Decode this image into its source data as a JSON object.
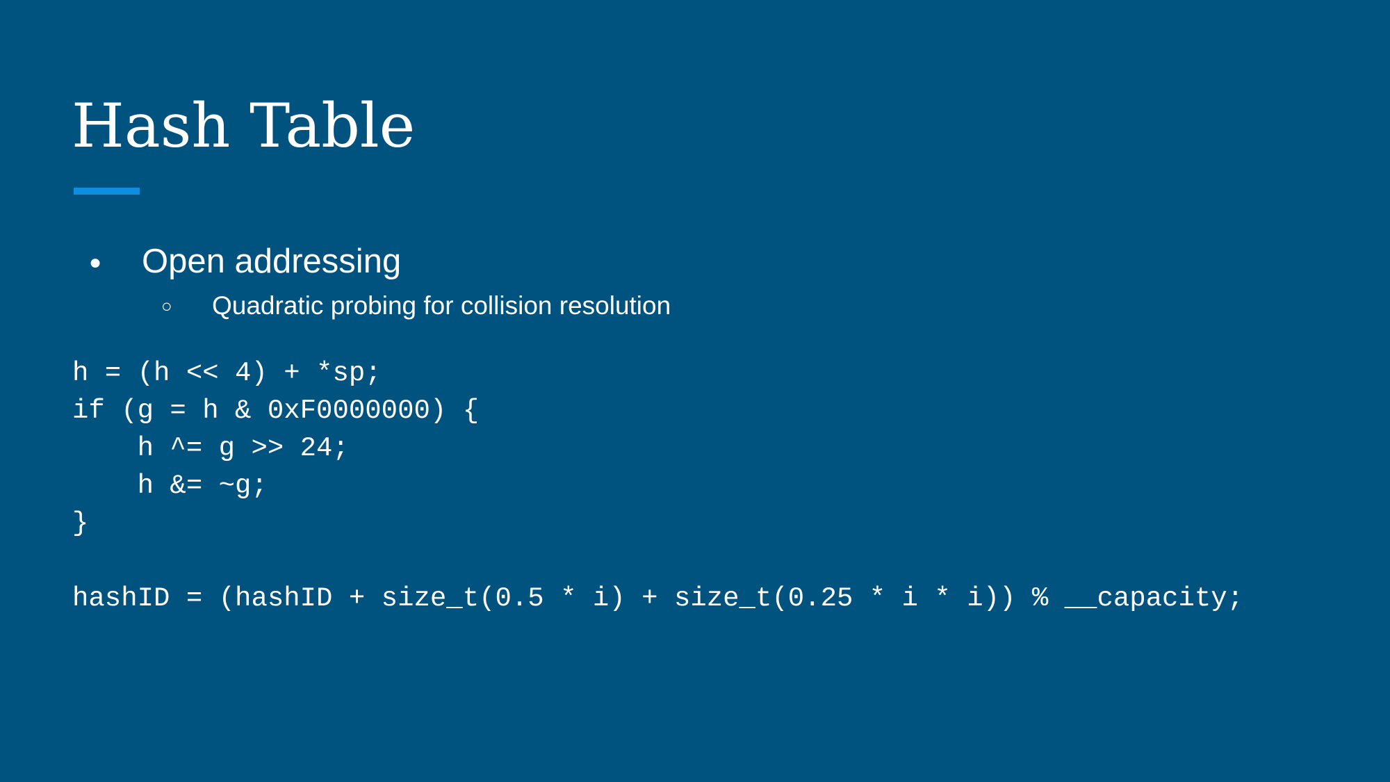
{
  "slide": {
    "title": "Hash Table",
    "accent_color": "#0d8ee0",
    "background_color": "#00527f",
    "bullets": [
      {
        "level": 1,
        "marker": "●",
        "text": "Open addressing"
      },
      {
        "level": 2,
        "marker": "○",
        "text": "Quadratic probing for collision resolution"
      }
    ],
    "code_lines": [
      "h = (h << 4) + *sp;",
      "if (g = h & 0xF0000000) {",
      "    h ^= g >> 24;",
      "    h &= ~g;",
      "}",
      "",
      "hashID = (hashID + size_t(0.5 * i) + size_t(0.25 * i * i)) % __capacity;"
    ]
  }
}
